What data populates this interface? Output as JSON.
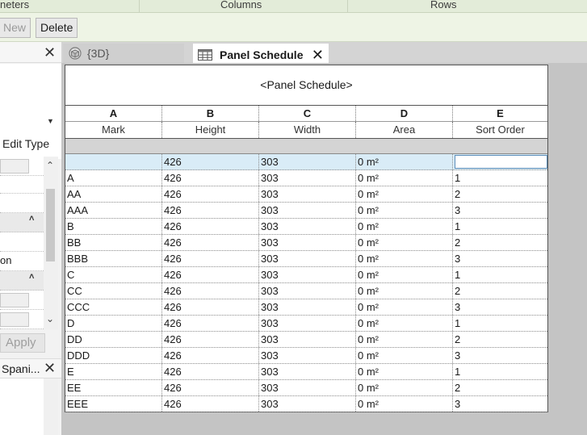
{
  "ribbon": {
    "panels": [
      "neters",
      "Columns",
      "Rows"
    ],
    "new_label": "New",
    "delete_label": "Delete"
  },
  "properties": {
    "close": "✕",
    "edit_type": "Edit Type",
    "row_on": "on",
    "apply": "Apply",
    "browser_title": "Spani...",
    "browser_close": "✕"
  },
  "tabs": [
    {
      "label": "{3D}",
      "active": false
    },
    {
      "label": "Panel Schedule",
      "active": true,
      "close": "✕"
    }
  ],
  "schedule": {
    "title": "<Panel Schedule>",
    "column_letters": [
      "A",
      "B",
      "C",
      "D",
      "E"
    ],
    "column_names": [
      "Mark",
      "Height",
      "Width",
      "Area",
      "Sort Order"
    ],
    "rows": [
      [
        "",
        "426",
        "303",
        "0 m²",
        ""
      ],
      [
        "A",
        "426",
        "303",
        "0 m²",
        "1"
      ],
      [
        "AA",
        "426",
        "303",
        "0 m²",
        "2"
      ],
      [
        "AAA",
        "426",
        "303",
        "0 m²",
        "3"
      ],
      [
        "B",
        "426",
        "303",
        "0 m²",
        "1"
      ],
      [
        "BB",
        "426",
        "303",
        "0 m²",
        "2"
      ],
      [
        "BBB",
        "426",
        "303",
        "0 m²",
        "3"
      ],
      [
        "C",
        "426",
        "303",
        "0 m²",
        "1"
      ],
      [
        "CC",
        "426",
        "303",
        "0 m²",
        "2"
      ],
      [
        "CCC",
        "426",
        "303",
        "0 m²",
        "3"
      ],
      [
        "D",
        "426",
        "303",
        "0 m²",
        "1"
      ],
      [
        "DD",
        "426",
        "303",
        "0 m²",
        "2"
      ],
      [
        "DDD",
        "426",
        "303",
        "0 m²",
        "3"
      ],
      [
        "E",
        "426",
        "303",
        "0 m²",
        "1"
      ],
      [
        "EE",
        "426",
        "303",
        "0 m²",
        "2"
      ],
      [
        "EEE",
        "426",
        "303",
        "0 m²",
        "3"
      ]
    ]
  }
}
